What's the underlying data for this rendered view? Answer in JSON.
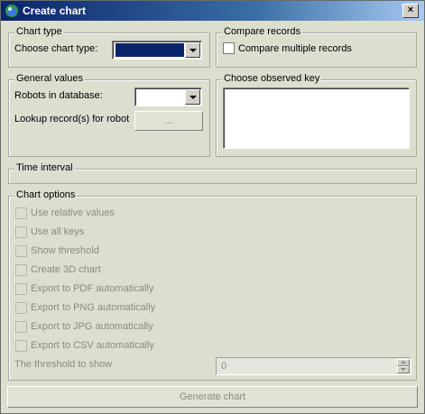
{
  "window": {
    "title": "Create chart",
    "close_label": "×"
  },
  "chart_type": {
    "legend": "Chart type",
    "choose_label": "Choose chart type:"
  },
  "compare_records": {
    "legend": "Compare records",
    "checkbox_label": "Compare multiple records",
    "checked": false
  },
  "general_values": {
    "legend": "General values",
    "robots_label": "Robots in database:",
    "lookup_label": "Lookup record(s) for robot",
    "lookup_button": "..."
  },
  "observed_key": {
    "legend": "Choose observed key"
  },
  "time_interval": {
    "legend": "Time interval"
  },
  "chart_options": {
    "legend": "Chart options",
    "options": [
      "Use relative values",
      "Use all keys",
      "Show threshold",
      "Create 3D chart",
      "Export to PDF automatically",
      "Export to PNG automatically",
      "Export to JPG automatically",
      "Export to CSV automatically"
    ],
    "threshold_label": "The threshold to show",
    "threshold_value": "0"
  },
  "generate_button": "Generate chart"
}
